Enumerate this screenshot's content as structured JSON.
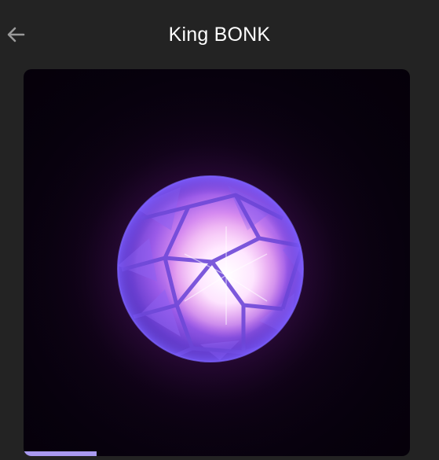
{
  "header": {
    "title": "King BONK",
    "back_icon": "arrow-left-icon"
  },
  "media": {
    "subject_icon": "glowing-orb-image",
    "progress": 0.19
  },
  "colors": {
    "background": "#232323",
    "accent": "#a99af0",
    "orb_glow": "#f6d8ff"
  }
}
